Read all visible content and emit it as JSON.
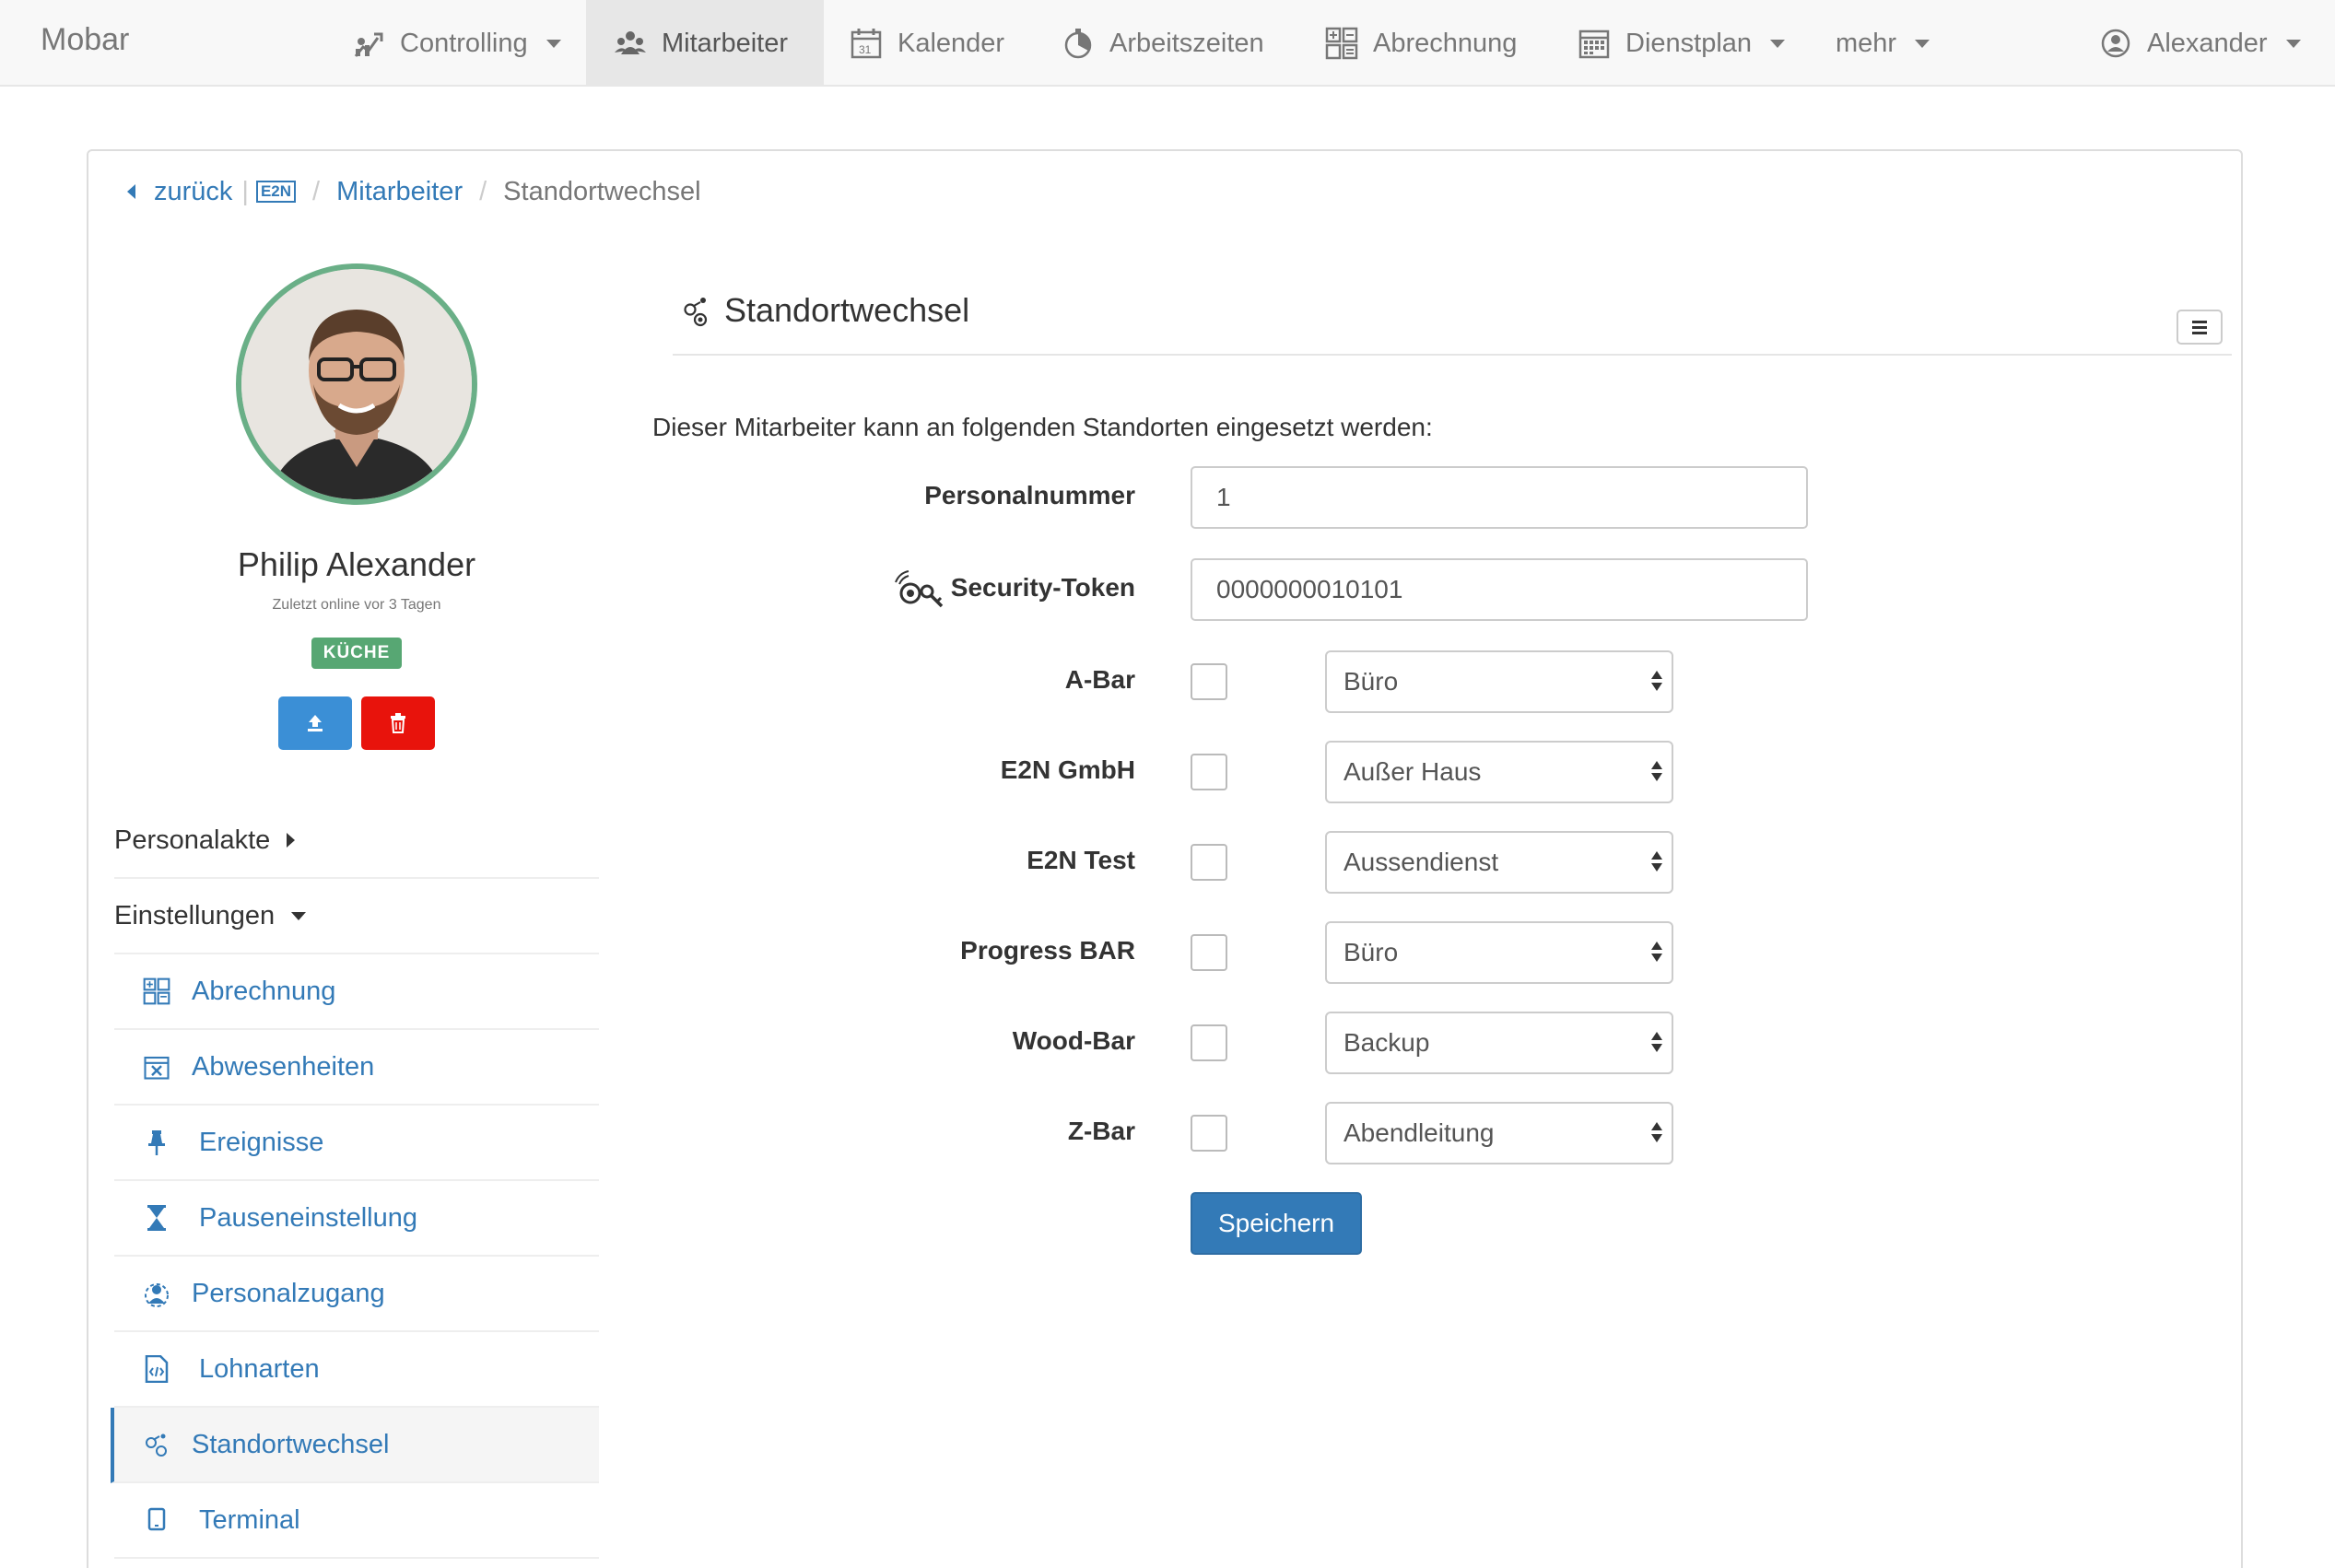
{
  "navbar": {
    "brand": "Mobar",
    "items": [
      {
        "label": "Controlling",
        "icon": "chart-people-icon",
        "dropdown": true
      },
      {
        "label": "Mitarbeiter",
        "icon": "team-icon",
        "active": true
      },
      {
        "label": "Kalender",
        "icon": "calendar-31-icon"
      },
      {
        "label": "Arbeitszeiten",
        "icon": "stopwatch-icon"
      },
      {
        "label": "Abrechnung",
        "icon": "calculator-icon"
      },
      {
        "label": "Dienstplan",
        "icon": "schedule-grid-icon",
        "dropdown": true
      },
      {
        "label": "mehr",
        "dropdown": true
      }
    ],
    "user": {
      "label": "Alexander",
      "icon": "user-circle-icon"
    }
  },
  "breadcrumb": {
    "back": "zurück",
    "badge": "E2N",
    "parent": "Mitarbeiter",
    "current": "Standortwechsel"
  },
  "profile": {
    "name": "Philip Alexander",
    "online": "Zuletzt online vor 3 Tagen",
    "badge": "KÜCHE"
  },
  "sidebar": {
    "sections": [
      {
        "label": "Personalakte",
        "state": "collapsed"
      },
      {
        "label": "Einstellungen",
        "state": "expanded"
      }
    ],
    "items": [
      {
        "label": "Abrechnung",
        "icon": "calculator-icon"
      },
      {
        "label": "Abwesenheiten",
        "icon": "calendar-x-icon"
      },
      {
        "label": "Ereignisse",
        "icon": "pin-icon"
      },
      {
        "label": "Pauseneinstellung",
        "icon": "hourglass-icon"
      },
      {
        "label": "Personalzugang",
        "icon": "user-access-icon"
      },
      {
        "label": "Lohnarten",
        "icon": "code-file-icon"
      },
      {
        "label": "Standortwechsel",
        "icon": "location-switch-icon",
        "active": true
      },
      {
        "label": "Terminal",
        "icon": "tablet-icon"
      }
    ]
  },
  "content": {
    "title": "Standortwechsel",
    "intro": "Dieser Mitarbeiter kann an folgenden Standorten eingesetzt werden:",
    "personalnummer": {
      "label": "Personalnummer",
      "value": "1"
    },
    "token": {
      "label": "Security-Token",
      "value": "0000000010101"
    },
    "locations": [
      {
        "name": "A-Bar",
        "checked": false,
        "role": "Büro"
      },
      {
        "name": "E2N GmbH",
        "checked": false,
        "role": "Außer Haus"
      },
      {
        "name": "E2N Test",
        "checked": false,
        "role": "Aussendienst"
      },
      {
        "name": "Progress BAR",
        "checked": false,
        "role": "Büro"
      },
      {
        "name": "Wood-Bar",
        "checked": false,
        "role": "Backup"
      },
      {
        "name": "Z-Bar",
        "checked": false,
        "role": "Abendleitung"
      }
    ],
    "save_label": "Speichern"
  },
  "colors": {
    "primary": "#337ab7",
    "badge_green": "#57a773",
    "avatar_border": "#6aaf87",
    "delete_red": "#e8130c",
    "upload_blue": "#3b8fd6"
  }
}
